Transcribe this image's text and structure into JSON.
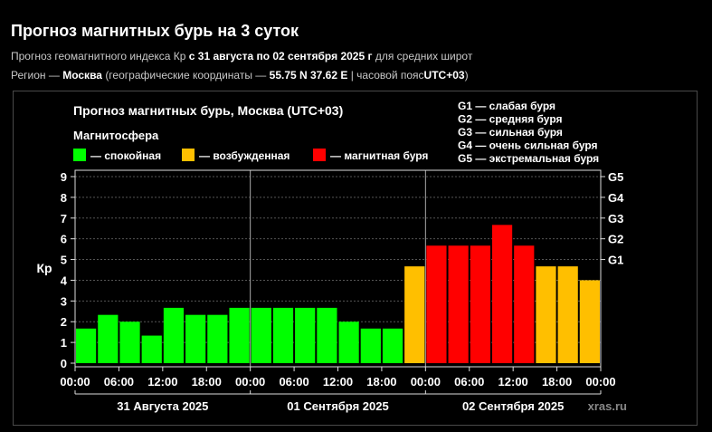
{
  "header": {
    "title": "Прогноз магнитных бурь на 3 суток",
    "line1_prefix": "Прогноз геомагнитного индекса Кр",
    "line1_period": "с 31 августа по 02 сентября 2025 г",
    "line1_suffix": "для средних широт",
    "line2_prefix": "Регион —",
    "line2_region": "Москва",
    "line2_coords_label": "(географические координаты —",
    "line2_coords": "55.75 N 37.62 E",
    "line2_tz_label": "| часовой пояс",
    "line2_tz": "UTC+03",
    "line2_close": ")"
  },
  "chart_data": {
    "type": "bar",
    "title": "Прогноз магнитных бурь, Москва (UTC+03)",
    "legend_title": "Магнитосфера",
    "legend": [
      {
        "label": "— спокойная",
        "color": "#00ff00"
      },
      {
        "label": "— возбужденная",
        "color": "#ffbf00"
      },
      {
        "label": "— магнитная буря",
        "color": "#ff0000"
      }
    ],
    "storm_scale": [
      "G1 — слабая буря",
      "G2 — средняя буря",
      "G3 — сильная буря",
      "G4 — очень сильная буря",
      "G5 — экстремальная буря"
    ],
    "ylabel": "Кр",
    "ylim": [
      0,
      9
    ],
    "yticks": [
      "0",
      "1",
      "2",
      "3",
      "4",
      "5",
      "6",
      "7",
      "8",
      "9"
    ],
    "right_ticks": [
      {
        "label": "G1",
        "value": 5
      },
      {
        "label": "G2",
        "value": 6
      },
      {
        "label": "G3",
        "value": 7
      },
      {
        "label": "G4",
        "value": 8
      },
      {
        "label": "G5",
        "value": 9
      }
    ],
    "xtick_labels": [
      "00:00",
      "06:00",
      "12:00",
      "18:00",
      "00:00",
      "06:00",
      "12:00",
      "18:00",
      "00:00",
      "06:00",
      "12:00",
      "18:00",
      "00:00"
    ],
    "day_labels": [
      "31 Августа 2025",
      "01 Сентября 2025",
      "02 Сентября 2025"
    ],
    "bars_per_day": 8,
    "values": [
      1.67,
      2.33,
      2.0,
      1.33,
      2.67,
      2.33,
      2.33,
      2.67,
      2.67,
      2.67,
      2.67,
      2.67,
      2.0,
      1.67,
      1.67,
      4.67,
      5.67,
      5.67,
      5.67,
      6.67,
      5.67,
      4.67,
      4.67,
      4.0
    ],
    "colors": [
      "#00ff00",
      "#00ff00",
      "#00ff00",
      "#00ff00",
      "#00ff00",
      "#00ff00",
      "#00ff00",
      "#00ff00",
      "#00ff00",
      "#00ff00",
      "#00ff00",
      "#00ff00",
      "#00ff00",
      "#00ff00",
      "#00ff00",
      "#ffbf00",
      "#ff0000",
      "#ff0000",
      "#ff0000",
      "#ff0000",
      "#ff0000",
      "#ffbf00",
      "#ffbf00",
      "#ffbf00"
    ],
    "grid": true,
    "watermark": "xras.ru"
  }
}
